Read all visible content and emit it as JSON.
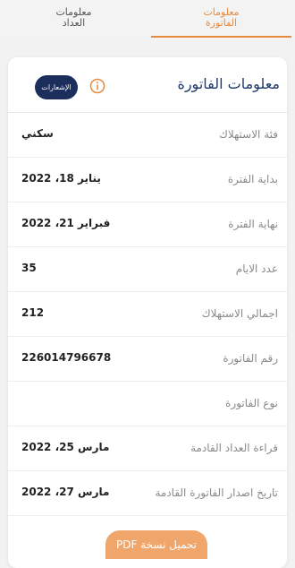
{
  "tabs": [
    {
      "label": "معلومات\nالفاتورة",
      "active": true
    },
    {
      "label": "معلومات\nالعداد",
      "active": false
    }
  ],
  "card": {
    "title": "معلومات الفاتورة",
    "notifications_label": "الإشعارات",
    "info_icon": "info-icon"
  },
  "rows": [
    {
      "label": "فئة الاستهلاك",
      "value": "سكني"
    },
    {
      "label": "بداية الفترة",
      "value": "يناير 18، 2022"
    },
    {
      "label": "نهاية الفترة",
      "value": "فبراير 21، 2022"
    },
    {
      "label": "عدد الايام",
      "value": "35"
    },
    {
      "label": "اجمالي الاستهلاك",
      "value": "212"
    },
    {
      "label": "رقم الفاتورة",
      "value": "226014796678"
    },
    {
      "label": "نوع الفاتورة",
      "value": ""
    },
    {
      "label": "قراءة العداد القادمة",
      "value": "مارس 25، 2022"
    },
    {
      "label": "تاريخ اصدار الفاتورة القادمة",
      "value": "مارس 27، 2022"
    }
  ],
  "download_label": "تحميل نسخة PDF",
  "colors": {
    "accent": "#e88b3f",
    "navy": "#1c2e5c",
    "title": "#1f3a6b"
  }
}
